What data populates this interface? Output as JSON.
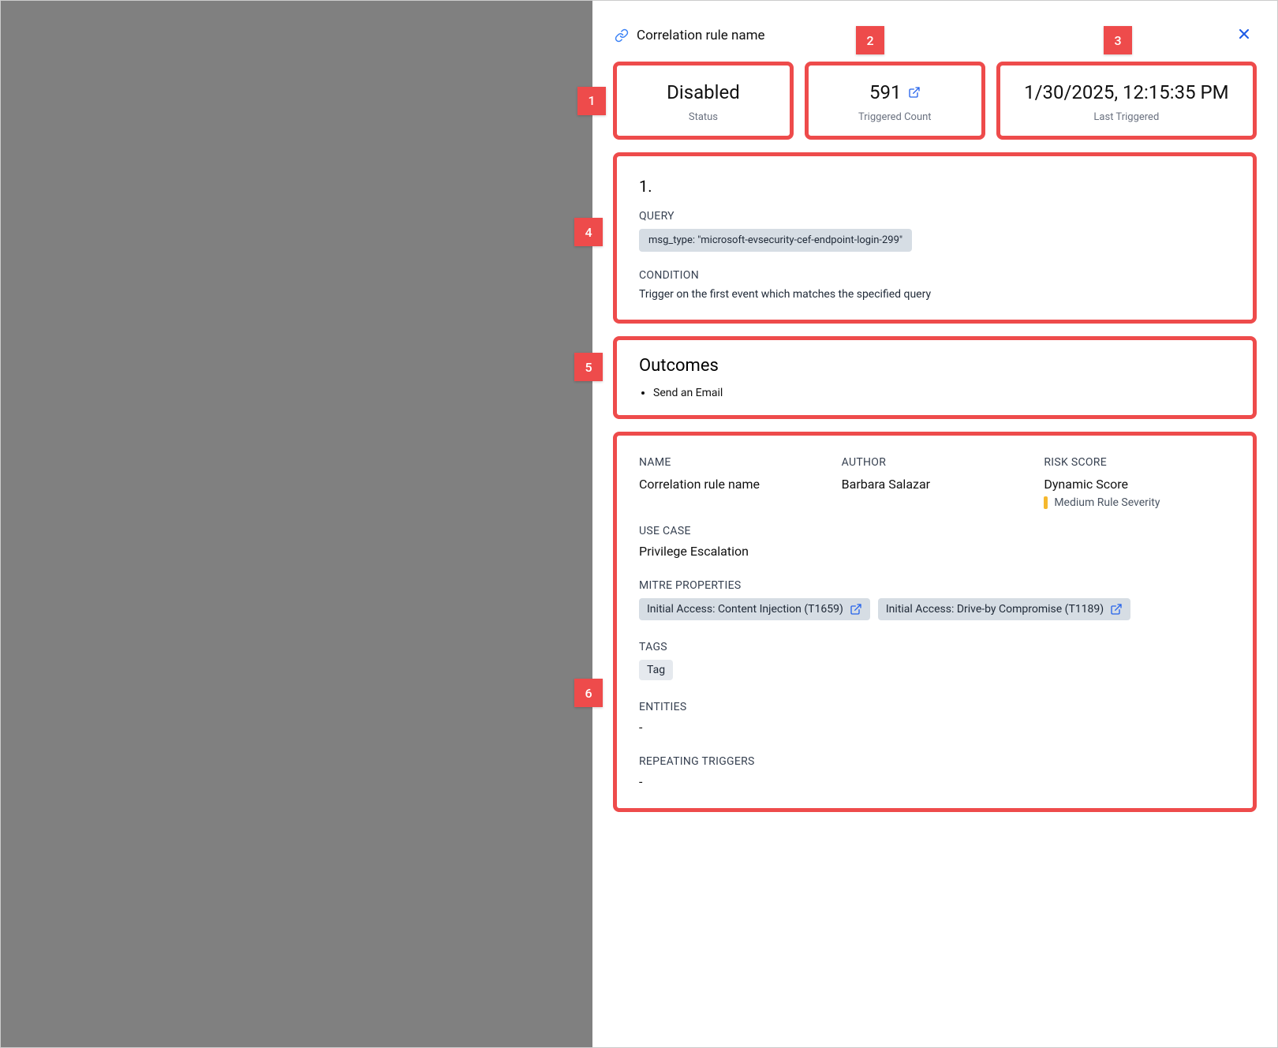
{
  "header": {
    "title": "Correlation rule name"
  },
  "stats": {
    "status": {
      "value": "Disabled",
      "label": "Status"
    },
    "triggered": {
      "value": "591",
      "label": "Triggered Count"
    },
    "last": {
      "value": "1/30/2025, 12:15:35 PM",
      "label": "Last Triggered"
    }
  },
  "query_section": {
    "num": "1.",
    "query_label": "QUERY",
    "query_value": "msg_type: \"microsoft-evsecurity-cef-endpoint-login-299\"",
    "condition_label": "CONDITION",
    "condition_text": "Trigger on the first event which matches the specified query"
  },
  "outcomes": {
    "title": "Outcomes",
    "items": [
      "Send an Email"
    ]
  },
  "details": {
    "name": {
      "label": "NAME",
      "value": "Correlation rule name"
    },
    "author": {
      "label": "AUTHOR",
      "value": "Barbara Salazar"
    },
    "risk": {
      "label": "RISK SCORE",
      "value": "Dynamic Score",
      "severity": "Medium Rule Severity"
    },
    "usecase": {
      "label": "USE CASE",
      "value": "Privilege Escalation"
    },
    "mitre": {
      "label": "MITRE PROPERTIES",
      "items": [
        "Initial Access: Content Injection (T1659)",
        "Initial Access: Drive-by Compromise (T1189)"
      ]
    },
    "tags": {
      "label": "TAGS",
      "items": [
        "Tag"
      ]
    },
    "entities": {
      "label": "ENTITIES",
      "value": "-"
    },
    "repeating": {
      "label": "REPEATING TRIGGERS",
      "value": "-"
    }
  },
  "callouts": {
    "c1": "1",
    "c2": "2",
    "c3": "3",
    "c4": "4",
    "c5": "5",
    "c6": "6"
  }
}
